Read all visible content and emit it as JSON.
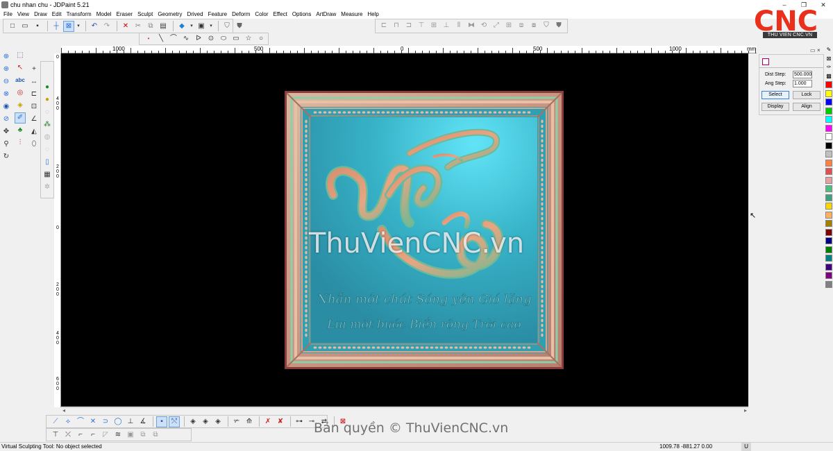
{
  "window": {
    "title": "chu nhan chu - JDPaint 5.21",
    "controls": [
      "–",
      "❐",
      "✕"
    ]
  },
  "menu": [
    "File",
    "View",
    "Draw",
    "Edit",
    "Transform",
    "Model",
    "Eraser",
    "Sculpt",
    "Geometry",
    "Drived",
    "Feature",
    "Deform",
    "Color",
    "Effect",
    "Options",
    "ArtDraw",
    "Measure",
    "Help"
  ],
  "ruler": {
    "unit": "mm",
    "h_labels": [
      "1000",
      "500",
      "0",
      "500",
      "1000"
    ],
    "v_labels": [
      "0",
      "4 0 0",
      "2 0 0",
      "0",
      "2 0 0",
      "4 0 0",
      "6 0 0"
    ]
  },
  "plaque": {
    "calligraphy_line1": "Nhẫn một chút Sóng yên Gió lặng",
    "calligraphy_line2": "Lùi một bước Biển rộng Trời cao"
  },
  "props_panel": {
    "dist_step_label": "Dist Step:",
    "dist_step_value": "500.000",
    "ang_step_label": "Ang Step:",
    "ang_step_value": "1.000",
    "select_label": "Select",
    "lock_label": "Lock",
    "display_label": "Display",
    "align_label": "Align"
  },
  "palette_colors": [
    "#ff0000",
    "#ffff00",
    "#0000ff",
    "#00cc00",
    "#00ffff",
    "#ff00ff",
    "#ffffff",
    "#000000",
    "#c0c0c0",
    "#ff8040",
    "#e05050",
    "#e8a0a0",
    "#4fbf80",
    "#40a080",
    "#ffd700",
    "#ffb060",
    "#a08000",
    "#800000",
    "#000080",
    "#008000",
    "#008080",
    "#400080",
    "#800080",
    "#808080"
  ],
  "logo": {
    "brand": "CNC",
    "subtitle": "THU VIEN CNC.VN"
  },
  "status": {
    "message": "Virtual Sculpting Tool: No object selected",
    "coords": "1009.78 -881.27 0.00",
    "unit_badge": "U"
  },
  "watermark": {
    "center": "ThuVienCNC.vn",
    "bottom": "Bản quyền © ThuVienCNC.vn"
  }
}
